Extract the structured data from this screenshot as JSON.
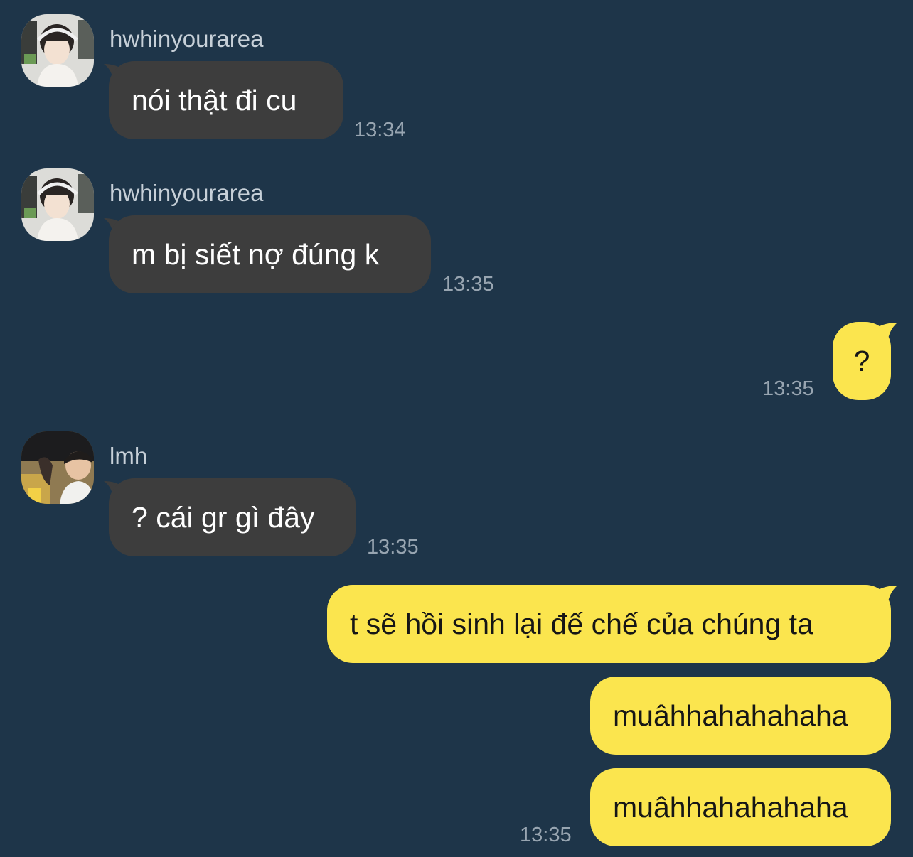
{
  "messages": [
    {
      "sender": "hwhinyourarea",
      "text": "nói thật đi cu",
      "time": "13:34"
    },
    {
      "sender": "hwhinyourarea",
      "text": "m bị siết nợ đúng k",
      "time": "13:35"
    },
    {
      "text": "?",
      "time": "13:35"
    },
    {
      "sender": "lmh",
      "text": "? cái gr gì đây",
      "time": "13:35"
    },
    {
      "text": "t sẽ hồi sinh lại đế chế của chúng ta"
    },
    {
      "text": "muâhhahahahaha"
    },
    {
      "text": "muâhhahahahaha",
      "time": "13:35"
    }
  ],
  "colors": {
    "background": "#1e3549",
    "incoming_bubble": "#3d3d3d",
    "outgoing_bubble": "#fbe54e",
    "timestamp": "#98a5b1",
    "sender_name": "#c7d0d8"
  }
}
